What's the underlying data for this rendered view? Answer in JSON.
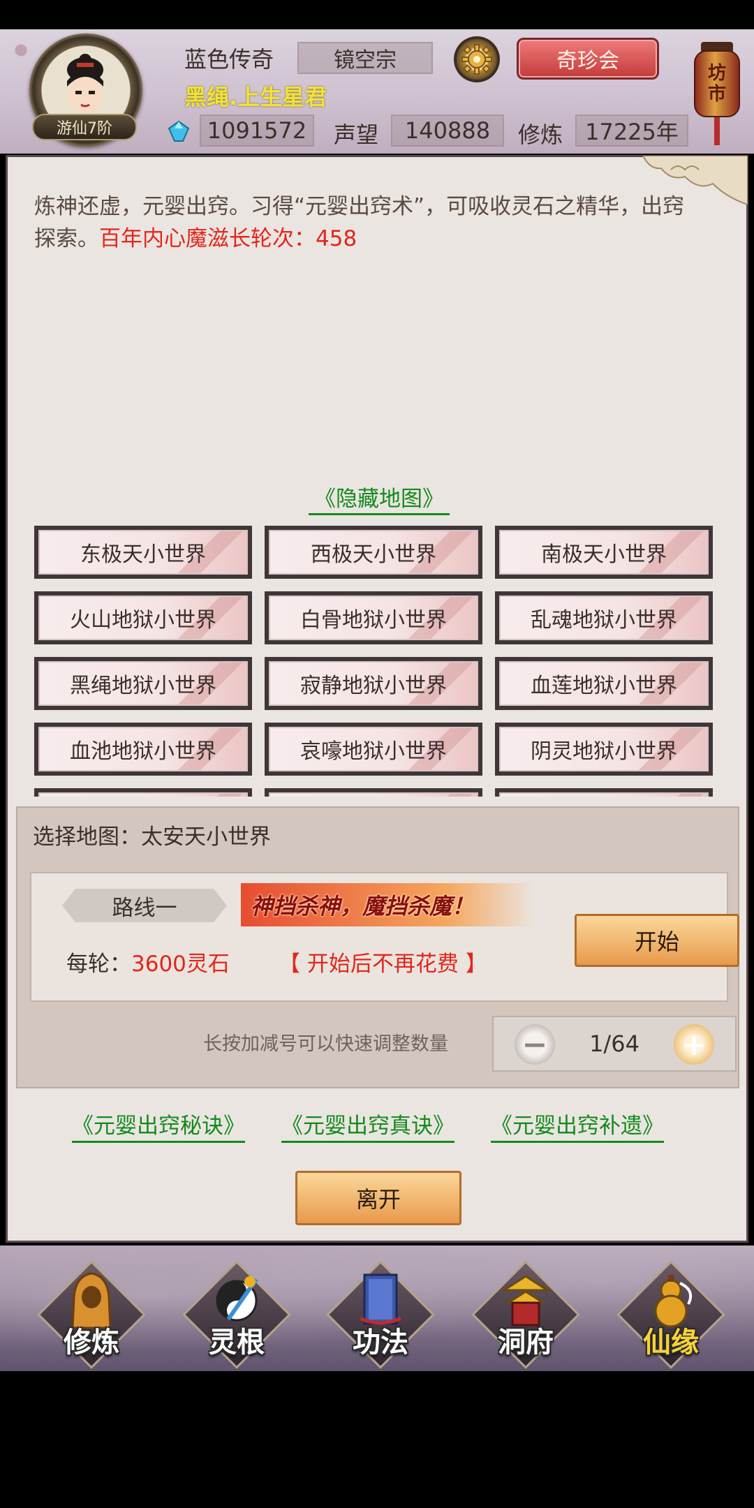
{
  "header": {
    "rank": "游仙7阶",
    "player_name": "蓝色传奇",
    "sect": "镜空宗",
    "treasure_button": "奇珍会",
    "title": "黑绳.上生星君",
    "spirit_stones": "1091572",
    "reputation_label": "声望",
    "reputation": "140888",
    "cultivation_label": "修炼",
    "cultivation": "17225年",
    "market_top": "坊",
    "market_bottom": "市"
  },
  "description": {
    "text": "炼神还虚，元婴出窍。习得“元婴出窍术”，可吸收灵石之精华，出窍探索。",
    "highlight": "百年内心魔滋长轮次：458"
  },
  "hidden_map_link": "《隐藏地图》",
  "worlds": [
    "东极天小世界",
    "西极天小世界",
    "南极天小世界",
    "火山地狱小世界",
    "白骨地狱小世界",
    "乱魂地狱小世界",
    "黑绳地狱小世界",
    "寂静地狱小世界",
    "血莲地狱小世界",
    "血池地狱小世界",
    "哀嚎地狱小世界",
    "阴灵地狱小世界"
  ],
  "selection": {
    "title": "选择地图：太安天小世界",
    "route_label": "路线一",
    "slogan": "神挡杀神，魔挡杀魔！",
    "cost_prefix": "每轮：",
    "cost_value": "3600灵石",
    "no_fee_note": "【 开始后不再花费 】",
    "start_button": "开始",
    "hint": "长按加减号可以快速调整数量",
    "quantity": "1/64"
  },
  "links": [
    "《元婴出窍秘诀》",
    "《元婴出窍真诀》",
    "《元婴出窍补遗》"
  ],
  "leave_button": "离开",
  "nav": [
    "修炼",
    "灵根",
    "功法",
    "洞府",
    "仙缘"
  ],
  "colors": {
    "accent_red": "#e2261b",
    "link_green": "#138a1c",
    "title_gold": "#f2e23a"
  }
}
